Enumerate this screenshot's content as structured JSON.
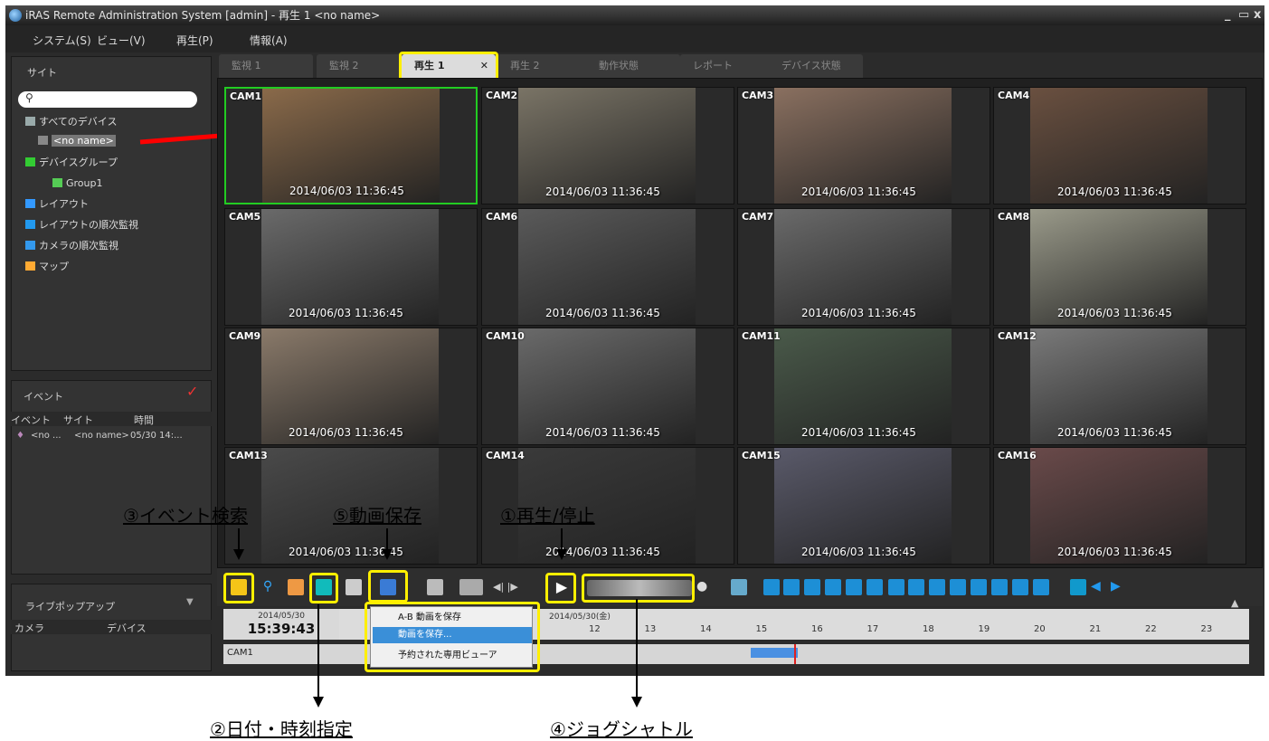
{
  "window": {
    "title": "iRAS Remote Administration System [admin] - 再生 1  <no name>",
    "controls": [
      "_",
      "▭",
      "x"
    ]
  },
  "menu": [
    "システム(S)",
    "ビュー(V)",
    "再生(P)",
    "情報(A)"
  ],
  "site_panel": {
    "title": "サイト",
    "tree": [
      "すべてのデバイス",
      "<no name>",
      "デバイスグループ",
      "Group1",
      "レイアウト",
      "レイアウトの順次監視",
      "カメラの順次監視",
      "マップ"
    ]
  },
  "event_panel": {
    "title": "イベント",
    "columns": [
      "イベント",
      "サイト",
      "時間"
    ],
    "row": [
      "<no ...",
      "<no name>",
      "05/30 14:..."
    ]
  },
  "live_popup_panel": {
    "title": "ライブポップアップ",
    "columns": [
      "カメラ",
      "デバイス"
    ]
  },
  "tabs": [
    {
      "label": "監視 1"
    },
    {
      "label": "監視 2"
    },
    {
      "label": "再生 1",
      "close": "✕"
    },
    {
      "label": "再生 2"
    },
    {
      "label": "動作状態"
    },
    {
      "label": "レポート"
    },
    {
      "label": "デバイス状態"
    }
  ],
  "cameras": [
    {
      "label": "CAM1",
      "ts": "2014/06/03  11:36:45"
    },
    {
      "label": "CAM2",
      "ts": "2014/06/03  11:36:45"
    },
    {
      "label": "CAM3",
      "ts": "2014/06/03  11:36:45"
    },
    {
      "label": "CAM4",
      "ts": "2014/06/03  11:36:45"
    },
    {
      "label": "CAM5",
      "ts": "2014/06/03  11:36:45"
    },
    {
      "label": "CAM6",
      "ts": "2014/06/03  11:36:45"
    },
    {
      "label": "CAM7",
      "ts": "2014/06/03  11:36:45"
    },
    {
      "label": "CAM8",
      "ts": "2014/06/03  11:36:45"
    },
    {
      "label": "CAM9",
      "ts": "2014/06/03  11:36:45"
    },
    {
      "label": "CAM10",
      "ts": "2014/06/03  11:36:45"
    },
    {
      "label": "CAM11",
      "ts": "2014/06/03  11:36:45"
    },
    {
      "label": "CAM12",
      "ts": "2014/06/03  11:36:45"
    },
    {
      "label": "CAM13",
      "ts": "2014/06/03  11:36:45"
    },
    {
      "label": "CAM14",
      "ts": "2014/06/03  11:36:45"
    },
    {
      "label": "CAM15",
      "ts": "2014/06/03  11:36:45"
    },
    {
      "label": "CAM16",
      "ts": "2014/06/03  11:36:45"
    }
  ],
  "timeline": {
    "date_small": "2014/05/30",
    "time": "15:39:43",
    "header_date": "2014/05/30(金)",
    "hours": [
      "12",
      "13",
      "14",
      "15",
      "16",
      "17",
      "18",
      "19",
      "20",
      "21",
      "22",
      "23"
    ],
    "row_label": "CAM1"
  },
  "popup_menu": [
    "A-B 動画を保存",
    "動画を保存...",
    "予約された専用ビューア"
  ],
  "callouts": {
    "event_search": "③イベント検索",
    "save_video": "⑤動画保存",
    "play_stop": "①再生/停止",
    "date_time": "②日付・時刻指定",
    "jog_shuttle": "④ジョグシャトル"
  },
  "colors": {
    "highlight": "#ffef00",
    "selected_border": "#22cc22",
    "annotation_arrow": "#ff0000",
    "timeline_bar": "#4a90e2",
    "timeline_cursor": "#e02020"
  }
}
